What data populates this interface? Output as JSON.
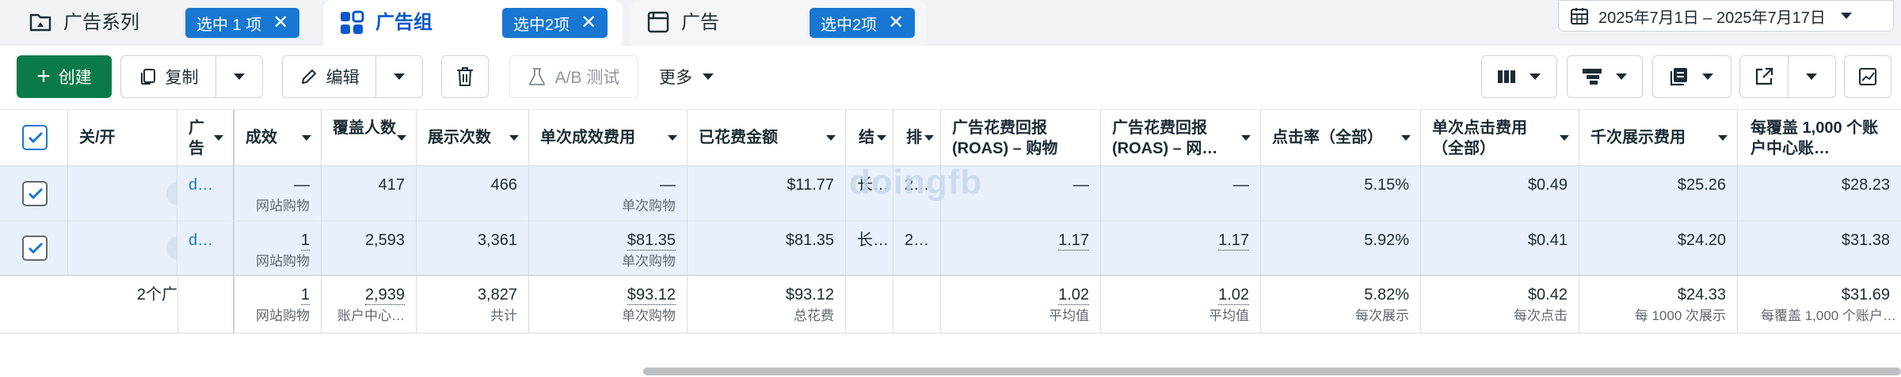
{
  "tabs": [
    {
      "label": "广告系列",
      "icon": "folder-icon",
      "pill": "选中 1 项"
    },
    {
      "label": "广告组",
      "icon": "grid-icon",
      "pill": "选中2项"
    },
    {
      "label": "广告",
      "icon": "ad-page-icon",
      "pill": "选中2项"
    }
  ],
  "date_range": "2025年7月1日 – 2025年7月17日",
  "toolbar": {
    "create": "创建",
    "copy": "复制",
    "edit": "编辑",
    "ab_test": "A/B 测试",
    "more": "更多"
  },
  "columns": {
    "toggle": "关/开",
    "ad": "广告",
    "results": "成效",
    "reach": "覆盖人数",
    "impressions": "展示次数",
    "cost_per_result": "单次成效费用",
    "amount_spent": "已花费金额",
    "narrow1": "结",
    "narrow2": "排",
    "roas_purchase": "广告花费回报 (ROAS) – 购物",
    "roas_web": "广告花费回报 (ROAS) – 网…",
    "ctr": "点击率（全部）",
    "cpc": "单次点击费用（全部）",
    "cpm": "千次展示费用",
    "cost_per_1000": "每覆盖 1,000 个账户中心账…"
  },
  "rows": [
    {
      "ad": "d…",
      "results": "—",
      "results_sub": "网站购物",
      "reach": "417",
      "impressions": "466",
      "cost_per_result": "—",
      "cost_per_result_sub": "单次购物",
      "amount_spent": "$11.77",
      "narrow1": "长…",
      "narrow2": "2…",
      "roas_purchase": "—",
      "roas_web": "—",
      "ctr": "5.15%",
      "cpc": "$0.49",
      "cpm": "$25.26",
      "cost_per_1000": "$28.23"
    },
    {
      "ad": "d…",
      "results": "1",
      "results_sub": "网站购物",
      "reach": "2,593",
      "impressions": "3,361",
      "cost_per_result": "$81.35",
      "cost_per_result_sub": "单次购物",
      "amount_spent": "$81.35",
      "narrow1": "长…",
      "narrow2": "2…",
      "roas_purchase": "1.17",
      "roas_web": "1.17",
      "ctr": "5.92%",
      "cpc": "$0.41",
      "cpm": "$24.20",
      "cost_per_1000": "$31.38"
    }
  ],
  "totals": {
    "label": "2个广",
    "results": "1",
    "results_sub": "网站购物",
    "reach": "2,939",
    "reach_sub": "账户中心…",
    "impressions": "3,827",
    "impressions_sub": "共计",
    "cost_per_result": "$93.12",
    "cost_per_result_sub": "单次购物",
    "amount_spent": "$93.12",
    "amount_spent_sub": "总花费",
    "roas_purchase": "1.02",
    "roas_purchase_sub": "平均值",
    "roas_web": "1.02",
    "roas_web_sub": "平均值",
    "ctr": "5.82%",
    "ctr_sub": "每次展示",
    "cpc": "$0.42",
    "cpc_sub": "每次点击",
    "cpm": "$24.33",
    "cpm_sub": "每 1000 次展示",
    "cost_per_1000": "$31.69",
    "cost_per_1000_sub": "每覆盖 1,000 个账户…"
  },
  "watermark": "doingfb",
  "colors": {
    "accent": "#1877d3",
    "create_button": "#0b7a4a",
    "selected_row": "#e8f1fb"
  }
}
